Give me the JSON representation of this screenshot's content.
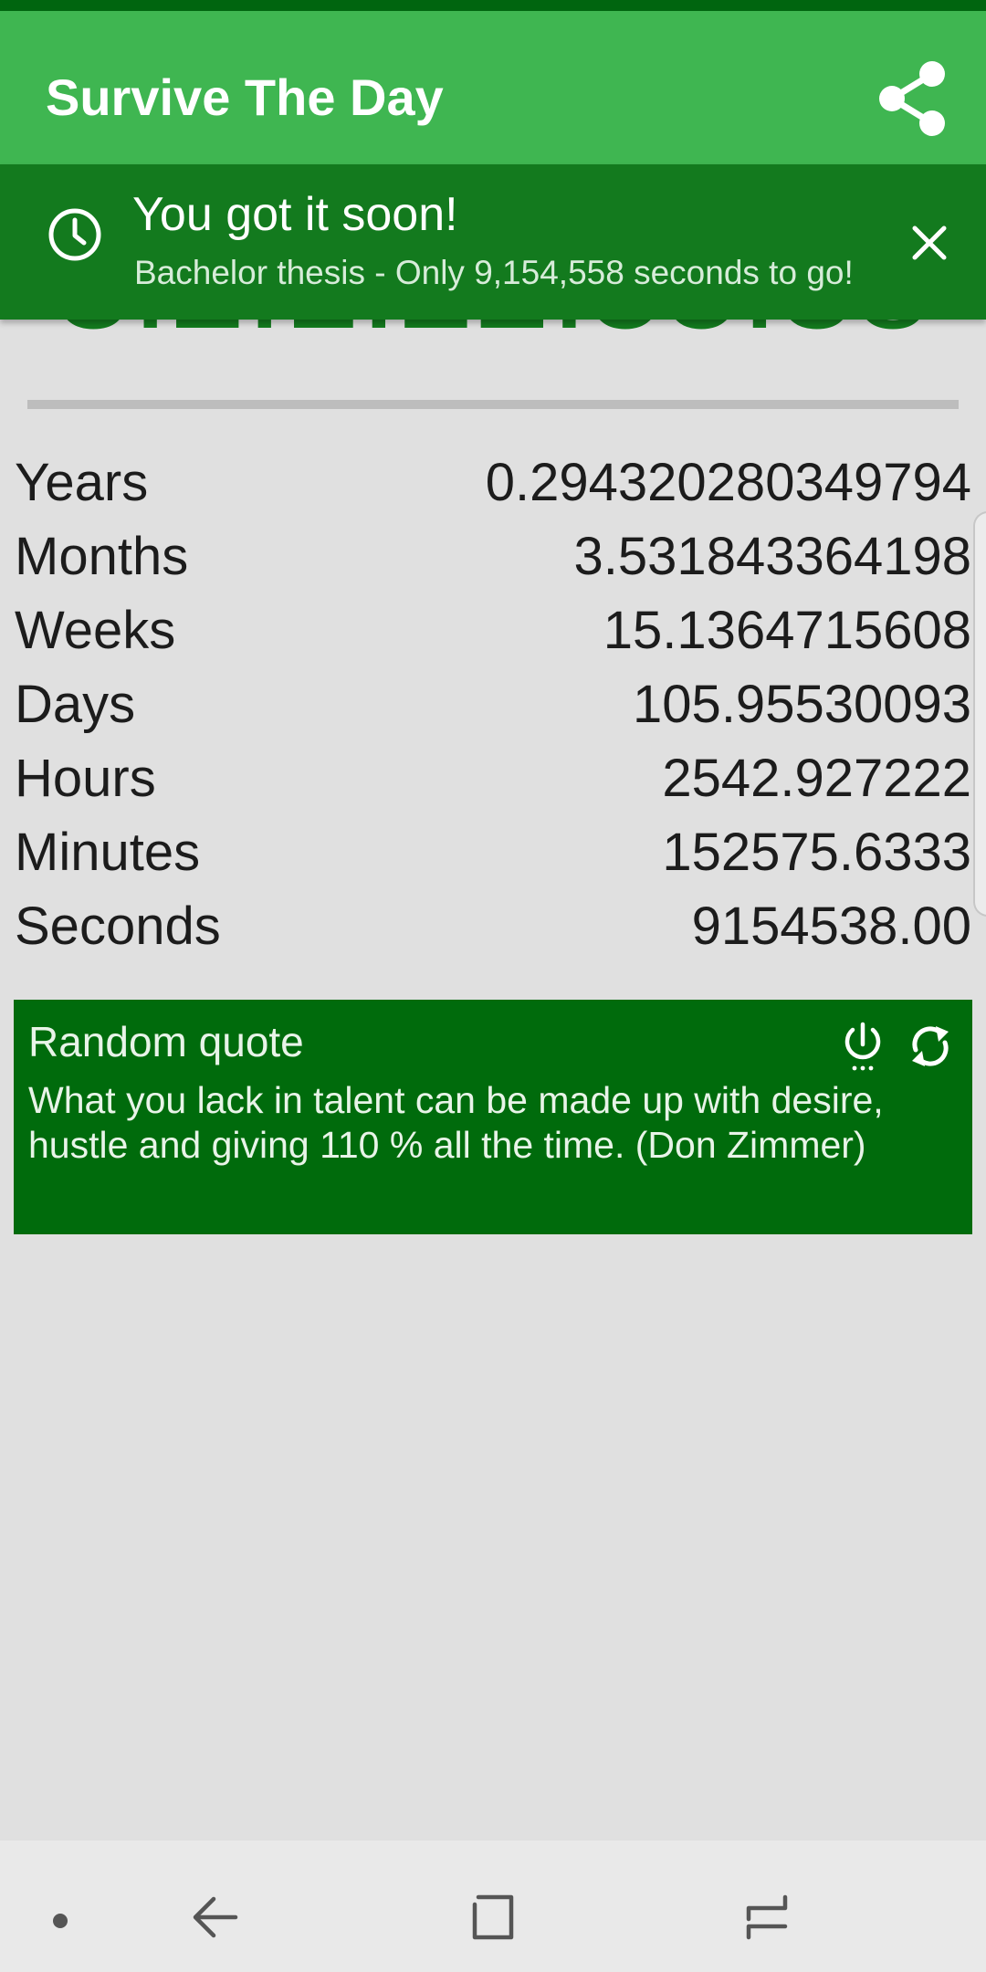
{
  "app": {
    "title": "Survive The Day",
    "accent_color": "#3fb651",
    "dark_color": "#137a1e"
  },
  "toolbar": {
    "share_icon": "share-icon"
  },
  "notification": {
    "icon": "clock-icon",
    "title": "You got it soon!",
    "body": "Bachelor thesis - Only 9,154,558 seconds to go!",
    "close_icon": "close-icon"
  },
  "countdown": {
    "display": "3:2:1:22:55:38"
  },
  "stats": [
    {
      "label": "Years",
      "value": "0.294320280349794"
    },
    {
      "label": "Months",
      "value": "3.531843364198"
    },
    {
      "label": "Weeks",
      "value": "15.1364715608"
    },
    {
      "label": "Days",
      "value": "105.95530093"
    },
    {
      "label": "Hours",
      "value": "2542.927222"
    },
    {
      "label": "Minutes",
      "value": "152575.6333"
    },
    {
      "label": "Seconds",
      "value": "9154538.00"
    }
  ],
  "quote": {
    "title": "Random quote",
    "text": "What you lack in talent can be made up with desire, hustle and giving 110 % all the time. (Don Zimmer)",
    "power_icon": "power-icon",
    "refresh_icon": "refresh-icon"
  },
  "nav": {
    "dot_icon": "dot-icon",
    "back_icon": "back-icon",
    "home_icon": "home-icon",
    "recents_icon": "recents-icon"
  }
}
